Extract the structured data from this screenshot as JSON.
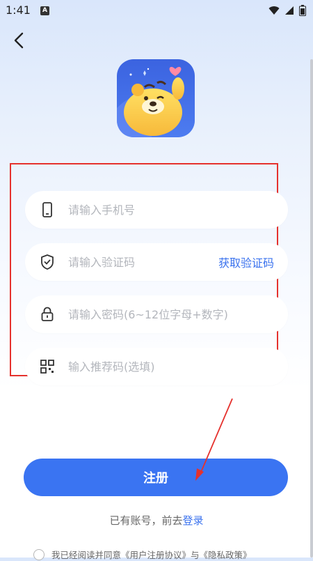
{
  "status_bar": {
    "time": "1:41",
    "notification_icon_letter": "A",
    "icons": [
      "wifi-icon",
      "signal-icon",
      "battery-icon"
    ]
  },
  "nav": {
    "back_icon": "chevron-left-icon"
  },
  "form": {
    "phone": {
      "icon": "phone-icon",
      "placeholder": "请输入手机号"
    },
    "code": {
      "icon": "shield-icon",
      "placeholder": "请输入验证码",
      "action_label": "获取验证码"
    },
    "password": {
      "icon": "lock-icon",
      "placeholder": "请输入密码(6~12位字母+数字)"
    },
    "referral": {
      "icon": "qr-code-icon",
      "placeholder": "输入推荐码(选填)"
    }
  },
  "register_button": {
    "label": "注册"
  },
  "login_prompt": {
    "text": "已有账号，前去",
    "link": "登录"
  },
  "agreement": {
    "text": "我已经阅读并同意《用户注册协议》与《隐私政策》"
  },
  "colors": {
    "accent": "#3a72ee",
    "button": "#3a74f2",
    "annotation": "#e5312d"
  }
}
